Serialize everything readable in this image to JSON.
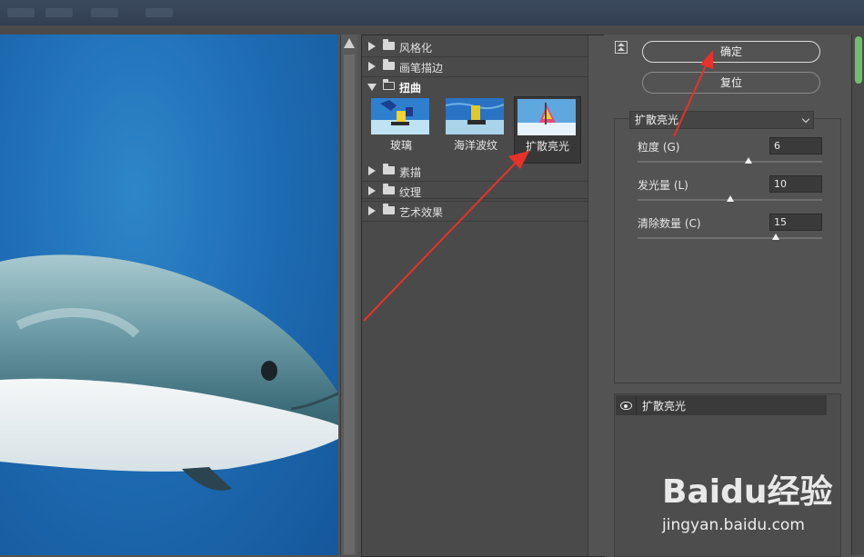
{
  "gallery": {
    "folders_top": [
      {
        "label": "风格化",
        "open": false
      },
      {
        "label": "画笔描边",
        "open": false
      },
      {
        "label": "扭曲",
        "open": true
      }
    ],
    "thumbnails": [
      {
        "caption": "玻璃",
        "selected": false
      },
      {
        "caption": "海洋波纹",
        "selected": false
      },
      {
        "caption": "扩散亮光",
        "selected": true
      }
    ],
    "folders_bottom": [
      {
        "label": "素描",
        "open": false
      },
      {
        "label": "纹理",
        "open": false
      },
      {
        "label": "艺术效果",
        "open": false
      }
    ]
  },
  "dialog": {
    "ok_label": "确定",
    "reset_label": "复位",
    "filter_select": "扩散亮光",
    "params": [
      {
        "label": "粒度 (G)",
        "value": "6",
        "fraction": 0.6
      },
      {
        "label": "发光量 (L)",
        "value": "10",
        "fraction": 0.5
      },
      {
        "label": "清除数量 (C)",
        "value": "15",
        "fraction": 0.75
      }
    ],
    "applied_layer": "扩散亮光"
  },
  "watermark": {
    "brand": "Baidu经验",
    "url": "jingyan.baidu.com"
  },
  "colors": {
    "annotation_arrow": "#e8312a",
    "panel_bg": "#535353",
    "preview_water": "#1f6db5"
  }
}
